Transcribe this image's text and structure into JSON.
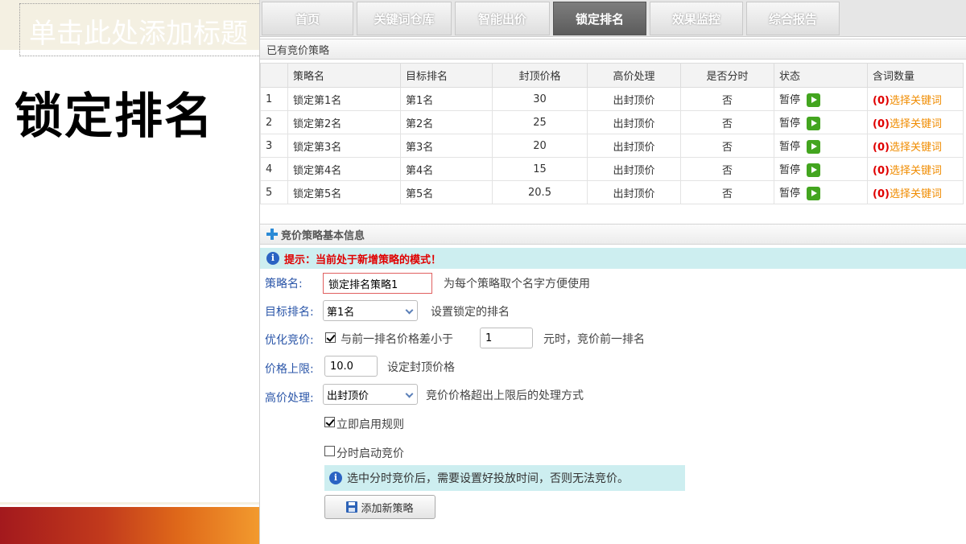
{
  "slide": {
    "title_placeholder": "单击此处添加标题",
    "heading": "锁定排名"
  },
  "tabs": [
    {
      "label": "首页",
      "active": false
    },
    {
      "label": "关键词仓库",
      "active": false
    },
    {
      "label": "智能出价",
      "active": false
    },
    {
      "label": "锁定排名",
      "active": true
    },
    {
      "label": "效果监控",
      "active": false
    },
    {
      "label": "综合报告",
      "active": false
    }
  ],
  "strategies": {
    "section_title": "已有竞价策略",
    "columns": [
      "",
      "策略名",
      "目标排名",
      "封顶价格",
      "高价处理",
      "是否分时",
      "状态",
      "含词数量"
    ],
    "rows": [
      {
        "no": "1",
        "name": "锁定第1名",
        "target": "第1名",
        "cap": "30",
        "high": "出封顶价",
        "timed": "否",
        "status": "暂停",
        "count": "(0)",
        "link": "选择关键词"
      },
      {
        "no": "2",
        "name": "锁定第2名",
        "target": "第2名",
        "cap": "25",
        "high": "出封顶价",
        "timed": "否",
        "status": "暂停",
        "count": "(0)",
        "link": "选择关键词"
      },
      {
        "no": "3",
        "name": "锁定第3名",
        "target": "第3名",
        "cap": "20",
        "high": "出封顶价",
        "timed": "否",
        "status": "暂停",
        "count": "(0)",
        "link": "选择关键词"
      },
      {
        "no": "4",
        "name": "锁定第4名",
        "target": "第4名",
        "cap": "15",
        "high": "出封顶价",
        "timed": "否",
        "status": "暂停",
        "count": "(0)",
        "link": "选择关键词"
      },
      {
        "no": "5",
        "name": "锁定第5名",
        "target": "第5名",
        "cap": "20.5",
        "high": "出封顶价",
        "timed": "否",
        "status": "暂停",
        "count": "(0)",
        "link": "选择关键词"
      }
    ]
  },
  "basic_info": {
    "section_title": "竞价策略基本信息",
    "mode_tip": "提示：当前处于新增策略的模式！"
  },
  "form": {
    "name_label": "策略名:",
    "name_value": "锁定排名策略1",
    "name_hint": "为每个策略取个名字方便使用",
    "target_label": "目标排名:",
    "target_value": "第1名",
    "target_hint": "设置锁定的排名",
    "optimize_label": "优化竞价:",
    "optimize_text": "与前一排名价格差小于",
    "optimize_value": "1",
    "optimize_suffix": "元时，竞价前一排名",
    "cap_label": "价格上限:",
    "cap_value": "10.0",
    "cap_hint": "设定封顶价格",
    "high_label": "高价处理:",
    "high_value": "出封顶价",
    "high_hint": "竞价价格超出上限后的处理方式",
    "enable_now": "立即启用规则",
    "timed_bidding": "分时启动竞价",
    "timed_note": "选中分时竞价后，需要设置好投放时间，否则无法竞价。",
    "add_button": "添加新策略"
  }
}
